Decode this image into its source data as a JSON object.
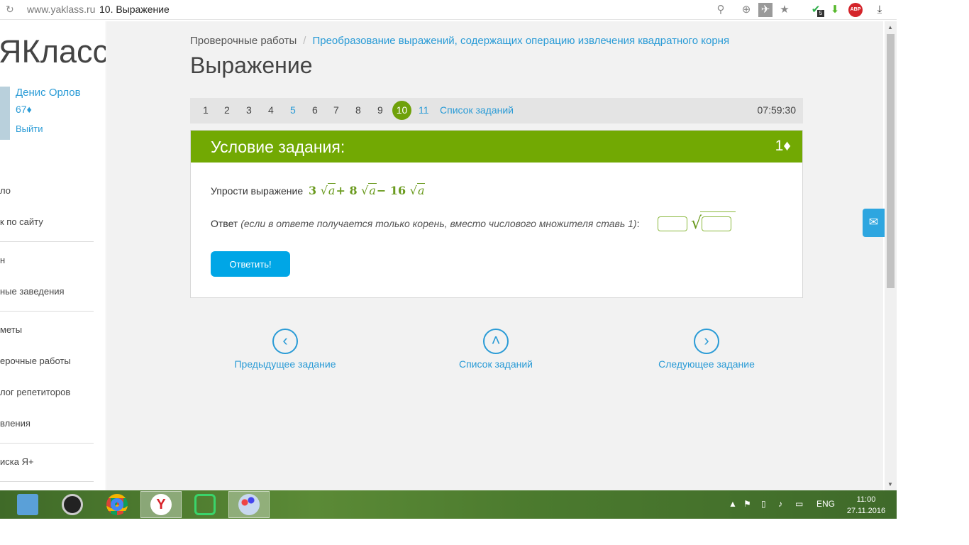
{
  "browser": {
    "url": "www.yaklass.ru",
    "page_title": "10. Выражение",
    "abp": "ABP",
    "ext_badge": "5"
  },
  "sidebar": {
    "logo": "ЯКласс",
    "user_name": "Денис Орлов",
    "user_points": "67♦",
    "logout": "Выйти",
    "items": [
      "ло",
      "к по сайту",
      "н",
      "ные заведения",
      "меты",
      "ерочные работы",
      "лог репетиторов",
      "вления",
      "иска Я+"
    ]
  },
  "breadcrumb": {
    "parent": "Проверочные работы",
    "separator": "/",
    "current": "Преобразование выражений, содержащих операцию извлечения квадратного корня"
  },
  "title": "Выражение",
  "task_nav": {
    "numbers": [
      "1",
      "2",
      "3",
      "4",
      "5",
      "6",
      "7",
      "8",
      "9",
      "10",
      "11"
    ],
    "current": "10",
    "list_link": "Список заданий",
    "timer": "07:59:30"
  },
  "task": {
    "header": "Условие задания:",
    "points": "1♦",
    "question_prefix": "Упрости выражение",
    "expr": {
      "c1": "3",
      "c2": "+ 8",
      "c3": "− 16",
      "var": "a",
      "sqrt": "√"
    },
    "answer_label": "Ответ",
    "answer_hint": "(если в ответе получается только корень, вместо числового множителя ставь 1)",
    "answer_colon": ":",
    "coef_value": "",
    "radicand_value": "",
    "submit": "Ответить!"
  },
  "bottom_nav": {
    "prev": {
      "label": "Предыдущее задание",
      "icon": "chevron-left-icon",
      "glyph": "‹"
    },
    "list": {
      "label": "Список заданий",
      "icon": "chevron-up-icon",
      "glyph": "˄"
    },
    "next": {
      "label": "Следующее задание",
      "icon": "chevron-right-icon",
      "glyph": "›"
    }
  },
  "taskbar": {
    "lang": "ENG",
    "time": "11:00",
    "date": "27.11.2016"
  },
  "colors": {
    "accent_green": "#72a903",
    "link_blue": "#2a9bd6",
    "button_blue": "#00a6e6"
  }
}
